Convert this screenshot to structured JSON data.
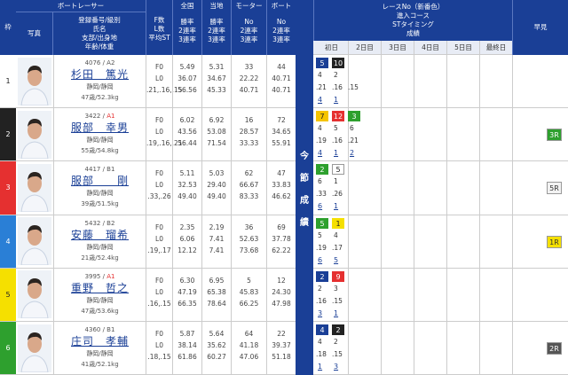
{
  "header": {
    "lane": "枠",
    "photo": "写真",
    "racer_title": "ボートレーサー",
    "racer_sub": [
      "登録番号/級別",
      "氏名",
      "支部/出身地",
      "年齢/体重"
    ],
    "fls": [
      "F数",
      "L数",
      "平均ST"
    ],
    "national": [
      "全国",
      "勝率",
      "2連率",
      "3連率"
    ],
    "local": [
      "当地",
      "勝率",
      "2連率",
      "3連率"
    ],
    "motor": [
      "モーター",
      "No",
      "2連率",
      "3連率"
    ],
    "boat": [
      "ボート",
      "No",
      "2連率",
      "3連率"
    ],
    "race": [
      "レースNo（新番色）",
      "進入コース",
      "STタイミング",
      "成績"
    ],
    "days": [
      "初日",
      "2日目",
      "3日目",
      "4日目",
      "5日目",
      "最終日"
    ],
    "early": "早見"
  },
  "middle_label": [
    "今",
    "節",
    "成",
    "績"
  ],
  "racers": [
    {
      "lane": "1",
      "lane_color": "#ffffff",
      "reg": "4076 / A2",
      "cls_red": false,
      "name": "杉田　篤光",
      "home": "静岡/静岡",
      "age": "47歳/52.3kg",
      "f": "F0",
      "l": "L0",
      "st": [
        ".21",
        ".16",
        ".15"
      ],
      "nat": [
        "5.49",
        "36.07",
        "56.56"
      ],
      "loc": [
        "5.31",
        "34.67",
        "45.33"
      ],
      "mot": [
        "33",
        "22.22",
        "40.71"
      ],
      "boat": [
        "44",
        "40.71",
        "40.71"
      ],
      "tags": [
        {
          "t": "5",
          "c": "#1a3f96"
        },
        {
          "t": "10",
          "c": "#222"
        }
      ],
      "course": [
        "4",
        "2"
      ],
      "res": [
        "4",
        "1"
      ],
      "early": "",
      "early_c": ""
    },
    {
      "lane": "2",
      "lane_color": "#222",
      "reg": "3422 / ",
      "cls": "A1",
      "cls_red": true,
      "name": "服部　幸男",
      "home": "静岡/静岡",
      "age": "55歳/54.8kg",
      "f": "F0",
      "l": "L0",
      "st": [
        ".19",
        ".16",
        ".21"
      ],
      "nat": [
        "6.02",
        "43.56",
        "56.44"
      ],
      "loc": [
        "6.92",
        "53.08",
        "71.54"
      ],
      "mot": [
        "16",
        "28.57",
        "33.33"
      ],
      "boat": [
        "72",
        "34.65",
        "55.91"
      ],
      "tags": [
        {
          "t": "7",
          "c": "#f5c400"
        },
        {
          "t": "12",
          "c": "#e53030"
        },
        {
          "t": "3",
          "c": "#2ea02e"
        }
      ],
      "course": [
        "4",
        "5",
        "6"
      ],
      "res": [
        "4",
        "1",
        "2"
      ],
      "early": "3R",
      "early_c": "#2ea02e"
    },
    {
      "lane": "3",
      "lane_color": "#e53030",
      "reg": "4417 / B1",
      "cls_red": false,
      "name": "服部　　剛",
      "home": "静岡/静岡",
      "age": "39歳/51.5kg",
      "f": "F0",
      "l": "L0",
      "st": [
        ".33",
        ".26"
      ],
      "nat": [
        "5.11",
        "32.53",
        "49.40"
      ],
      "loc": [
        "5.03",
        "29.40",
        "49.40"
      ],
      "mot": [
        "62",
        "66.67",
        "83.33"
      ],
      "boat": [
        "47",
        "33.83",
        "46.62"
      ],
      "tags": [
        {
          "t": "2",
          "c": "#2ea02e"
        },
        {
          "t": "5",
          "c": "#ffffff"
        }
      ],
      "course": [
        "6",
        "1"
      ],
      "res": [
        "6",
        "1"
      ],
      "early": "5R",
      "early_c": "#f2f2f2"
    },
    {
      "lane": "4",
      "lane_color": "#2a7fd6",
      "reg": "5432 / B2",
      "cls_red": false,
      "name": "安藤　瑠希",
      "home": "静岡/静岡",
      "age": "21歳/52.4kg",
      "f": "F0",
      "l": "L0",
      "st": [
        ".19",
        ".17"
      ],
      "nat": [
        "2.35",
        "6.06",
        "12.12"
      ],
      "loc": [
        "2.19",
        "7.41",
        "7.41"
      ],
      "mot": [
        "36",
        "52.63",
        "73.68"
      ],
      "boat": [
        "69",
        "37.78",
        "62.22"
      ],
      "tags": [
        {
          "t": "5",
          "c": "#2ea02e"
        },
        {
          "t": "1",
          "c": "#f5e000"
        }
      ],
      "course": [
        "5",
        "4"
      ],
      "res": [
        "6",
        "5"
      ],
      "early": "1R",
      "early_c": "#f5e000"
    },
    {
      "lane": "5",
      "lane_color": "#f5e000",
      "reg": "3995 / ",
      "cls": "A1",
      "cls_red": true,
      "name": "重野　哲之",
      "home": "静岡/静岡",
      "age": "47歳/53.6kg",
      "f": "F0",
      "l": "L0",
      "st": [
        ".16",
        ".15"
      ],
      "nat": [
        "6.30",
        "47.19",
        "66.35"
      ],
      "loc": [
        "6.95",
        "65.38",
        "78.64"
      ],
      "mot": [
        "5",
        "45.83",
        "66.25"
      ],
      "boat": [
        "12",
        "24.30",
        "47.98"
      ],
      "tags": [
        {
          "t": "2",
          "c": "#1a3f96"
        },
        {
          "t": "9",
          "c": "#e53030"
        }
      ],
      "course": [
        "2",
        "3"
      ],
      "res": [
        "3",
        "1"
      ],
      "early": "",
      "early_c": ""
    },
    {
      "lane": "6",
      "lane_color": "#2ea02e",
      "reg": "4360 / B1",
      "cls_red": false,
      "name": "庄司　孝輔",
      "home": "静岡/静岡",
      "age": "41歳/52.1kg",
      "f": "F0",
      "l": "L0",
      "st": [
        ".18",
        ".15"
      ],
      "nat": [
        "5.87",
        "38.14",
        "61.86"
      ],
      "loc": [
        "5.64",
        "35.62",
        "60.27"
      ],
      "mot": [
        "64",
        "41.18",
        "47.06"
      ],
      "boat": [
        "22",
        "39.37",
        "51.18"
      ],
      "tags": [
        {
          "t": "4",
          "c": "#1a3f96"
        },
        {
          "t": "2",
          "c": "#222"
        }
      ],
      "course": [
        "4",
        "2"
      ],
      "res": [
        "1",
        "3"
      ],
      "early": "2R",
      "early_c": "#555"
    }
  ]
}
